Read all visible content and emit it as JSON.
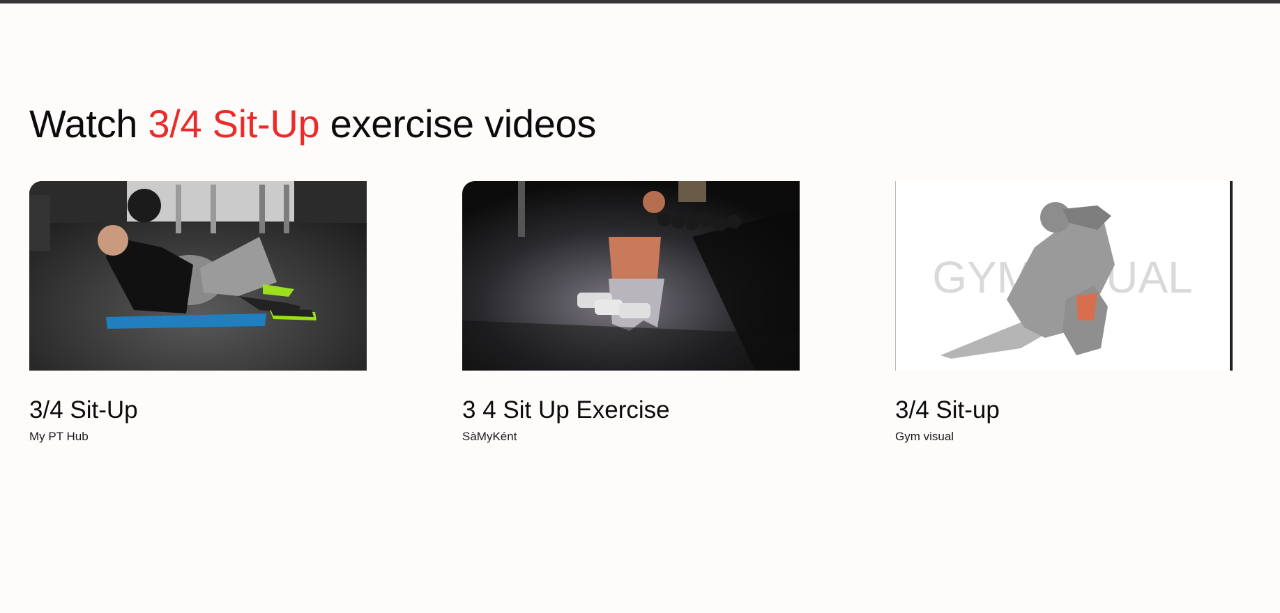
{
  "heading": {
    "prefix": "Watch ",
    "highlight": "3/4 Sit-Up",
    "suffix": " exercise videos"
  },
  "colors": {
    "accent": "#ec2a2a",
    "background": "#fefbfb",
    "top_bar": "#363636"
  },
  "videos": [
    {
      "title": "3/4 Sit-Up",
      "author": "My PT Hub"
    },
    {
      "title": "3 4 Sit Up Exercise",
      "author": "SàMyKént"
    },
    {
      "title": "3/4 Sit-up",
      "author": "Gym visual",
      "watermark": "GYMVISUAL"
    }
  ]
}
